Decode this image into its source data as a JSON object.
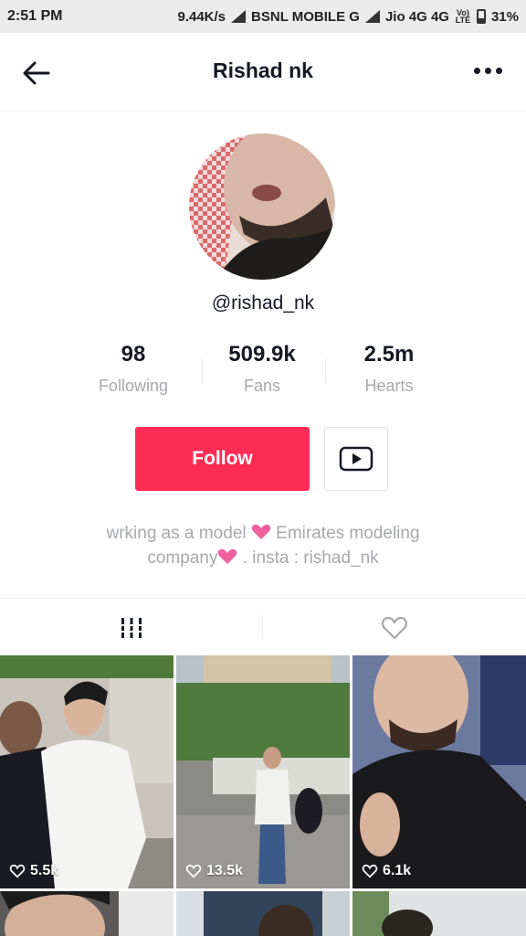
{
  "status_bar": {
    "time": "2:51 PM",
    "speed": "9.44K/s",
    "carrier1": "BSNL MOBILE G",
    "carrier2": "Jio 4G 4G",
    "volte": "Vo) LTE",
    "battery": "31%"
  },
  "nav": {
    "title": "Rishad nk",
    "back_icon": "arrow-left-icon",
    "more_icon": "more-horizontal-icon"
  },
  "profile": {
    "username": "@rishad_nk",
    "stats": [
      {
        "value": "98",
        "label": "Following"
      },
      {
        "value": "509.9k",
        "label": "Fans"
      },
      {
        "value": "2.5m",
        "label": "Hearts"
      }
    ],
    "follow_label": "Follow",
    "youtube_icon": "youtube-play-icon",
    "bio_line1_a": "wrking as a model",
    "bio_line1_b": "Emirates modeling",
    "bio_line2_a": "company",
    "bio_line2_b": ". insta : rishad_nk"
  },
  "tabs": [
    {
      "icon": "grid-videos-icon",
      "active": true
    },
    {
      "icon": "heart-outline-icon",
      "active": false
    }
  ],
  "videos": [
    {
      "likes": "5.5k"
    },
    {
      "likes": "13.5k"
    },
    {
      "likes": "6.1k"
    }
  ],
  "colors": {
    "accent": "#fe2c55",
    "text": "#161823",
    "muted": "#a7a8ad",
    "bio_heart": "#f0609c"
  }
}
